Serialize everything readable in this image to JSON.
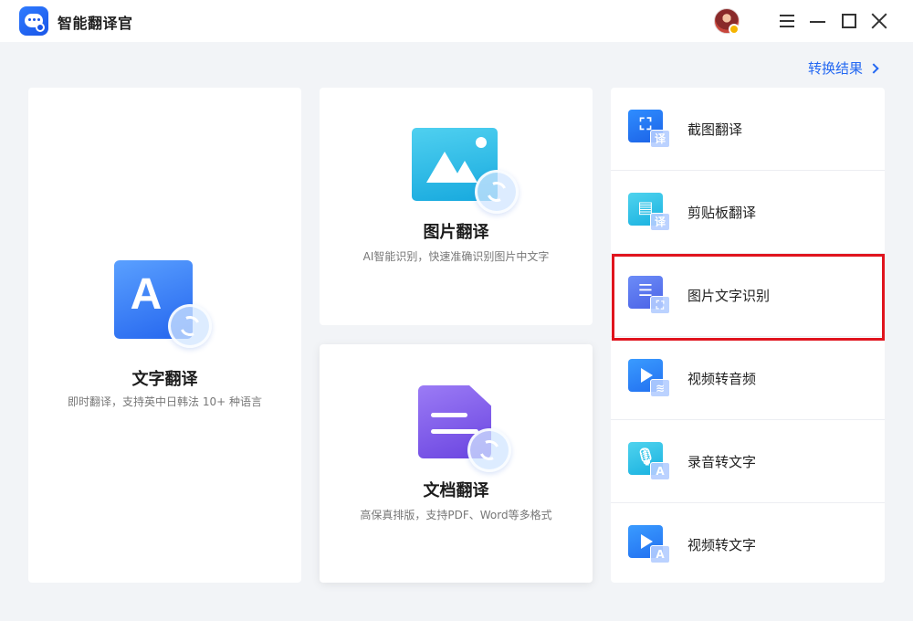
{
  "app": {
    "title": "智能翻译官"
  },
  "header": {
    "result_link": "转换结果"
  },
  "cards": {
    "text": {
      "title": "文字翻译",
      "desc": "即时翻译，支持英中日韩法 10+ 种语言",
      "icon_letter": "A"
    },
    "image": {
      "title": "图片翻译",
      "desc": "AI智能识别，快速准确识别图片中文字"
    },
    "doc": {
      "title": "文档翻译",
      "desc": "高保真排版，支持PDF、Word等多格式"
    }
  },
  "tools": [
    {
      "label": "截图翻译",
      "badge": "译",
      "icon": "screenshot-translate-icon"
    },
    {
      "label": "剪贴板翻译",
      "badge": "译",
      "icon": "clipboard-translate-icon"
    },
    {
      "label": "图片文字识别",
      "badge": "",
      "icon": "image-ocr-icon"
    },
    {
      "label": "视频转音频",
      "badge": "",
      "icon": "video-to-audio-icon"
    },
    {
      "label": "录音转文字",
      "badge": "A",
      "icon": "audio-to-text-icon"
    },
    {
      "label": "视频转文字",
      "badge": "A",
      "icon": "video-to-text-icon"
    }
  ],
  "colors": {
    "accent": "#2468f2",
    "highlight": "#e0141e",
    "background": "#f2f4f7"
  }
}
